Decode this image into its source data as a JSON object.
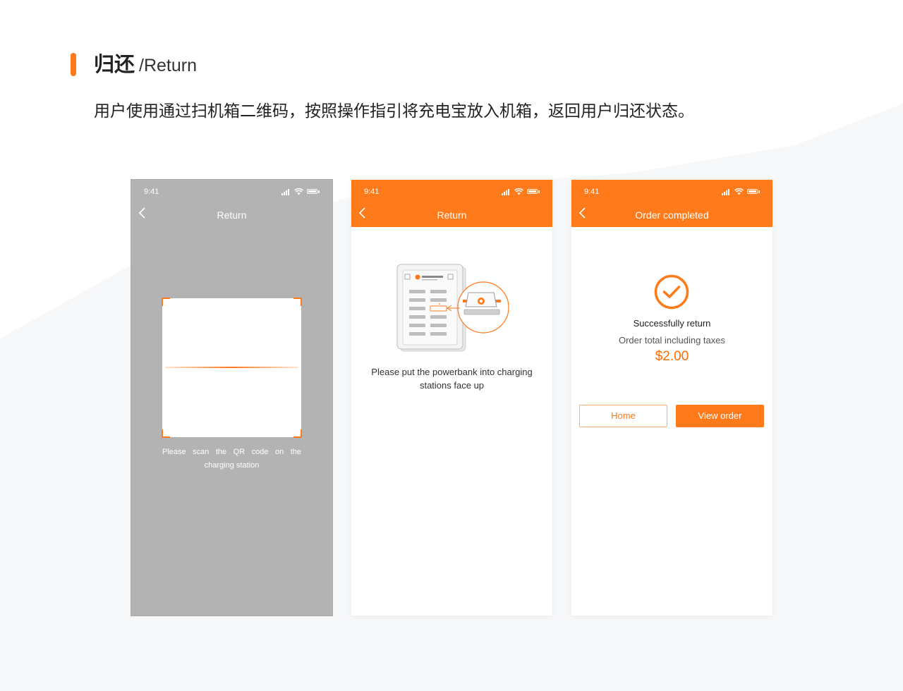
{
  "section": {
    "title_cn": "归还",
    "title_en": "/Return",
    "description": "用户使用通过扫机箱二维码，按照操作指引将充电宝放入机箱，返回用户归还状态。"
  },
  "theme": {
    "accent": "#ff7a1a",
    "price": "#ff6a00",
    "scan_bg": "#b3b3b3"
  },
  "screens": [
    {
      "status_time": "9:41",
      "nav_title": "Return",
      "scan_hint": "Please scan the QR code on the charging station"
    },
    {
      "status_time": "9:41",
      "nav_title": "Return",
      "instruction": "Please put the powerbank into charging stations face up"
    },
    {
      "status_time": "9:41",
      "nav_title": "Order completed",
      "success_title": "Successfully return",
      "order_total_label": "Order total including taxes",
      "order_total_amount": "$2.00",
      "buttons": {
        "home": "Home",
        "view_order": "View order"
      }
    }
  ]
}
